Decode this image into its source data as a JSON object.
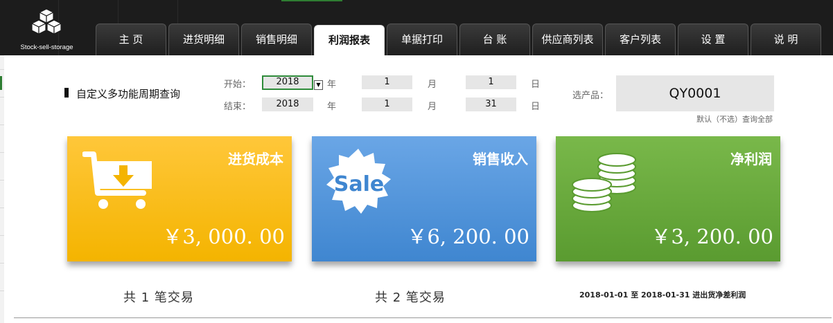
{
  "logo": {
    "text": "Stock-sell-storage"
  },
  "tabs": [
    {
      "label": "主 页",
      "active": false
    },
    {
      "label": "进货明细",
      "active": false
    },
    {
      "label": "销售明细",
      "active": false
    },
    {
      "label": "利润报表",
      "active": true
    },
    {
      "label": "单据打印",
      "active": false
    },
    {
      "label": "台 账",
      "active": false
    },
    {
      "label": "供应商列表",
      "active": false
    },
    {
      "label": "客户列表",
      "active": false
    },
    {
      "label": "设 置",
      "active": false
    },
    {
      "label": "说 明",
      "active": false
    }
  ],
  "query": {
    "title": "自定义多功能周期查询",
    "start_label": "开始：",
    "end_label": "结束：",
    "year_unit": "年",
    "month_unit": "月",
    "day_unit": "日",
    "start": {
      "year": "2018",
      "month": "1",
      "day": "1"
    },
    "end": {
      "year": "2018",
      "month": "1",
      "day": "31"
    },
    "product_label": "选产品：",
    "product_value": "QY0001",
    "product_hint": "默认（不选）查询全部"
  },
  "cards": {
    "cost": {
      "title": "进货成本",
      "amount": "￥3, 000. 00",
      "count": "共 1 笔交易",
      "icon": "cart-download-icon"
    },
    "sales": {
      "title": "销售收入",
      "amount": "￥6, 200. 00",
      "count": "共 2 笔交易",
      "icon": "sale-badge-icon"
    },
    "profit": {
      "title": "净利润",
      "amount": "￥3, 200. 00",
      "icon": "coins-icon"
    }
  },
  "summary": "2018-01-01 至 2018-01-31 进出货净差利润",
  "colors": {
    "cost": "#f4b400",
    "sales": "#3f86d0",
    "profit": "#5a9b30",
    "topbar": "#1c1c1c"
  }
}
